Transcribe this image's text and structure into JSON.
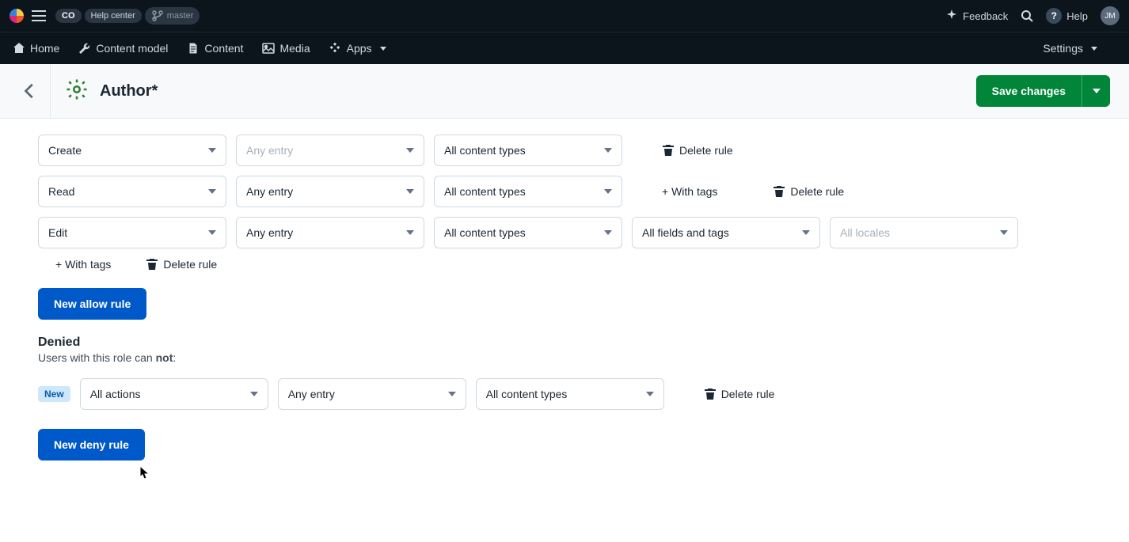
{
  "topbar": {
    "org_badge": "CO",
    "help_center": "Help center",
    "branch": "master",
    "feedback": "Feedback",
    "help": "Help",
    "avatar_initials": "JM"
  },
  "navbar": {
    "home": "Home",
    "content_model": "Content model",
    "content": "Content",
    "media": "Media",
    "apps": "Apps",
    "settings": "Settings"
  },
  "header": {
    "title": "Author*",
    "save_label": "Save changes"
  },
  "rules": {
    "allow": [
      {
        "action": "Create",
        "scope": "Any entry",
        "scope_placeholder": true,
        "types": "All content types",
        "actions": [
          {
            "kind": "delete",
            "label": "Delete rule"
          }
        ]
      },
      {
        "action": "Read",
        "scope": "Any entry",
        "types": "All content types",
        "actions": [
          {
            "kind": "tags",
            "label": "+ With tags"
          },
          {
            "kind": "delete",
            "label": "Delete rule"
          }
        ]
      },
      {
        "action": "Edit",
        "scope": "Any entry",
        "types": "All content types",
        "fields": "All fields and tags",
        "locales": "All locales",
        "locales_placeholder": true,
        "sub": [
          {
            "kind": "tags",
            "label": "+ With tags"
          },
          {
            "kind": "delete",
            "label": "Delete rule"
          }
        ]
      }
    ],
    "new_allow_btn": "New allow rule",
    "denied": {
      "heading": "Denied",
      "subtext_prefix": "Users with this role can ",
      "subtext_bold": "not",
      "subtext_suffix": ":",
      "new_badge": "New",
      "row": {
        "action": "All actions",
        "scope": "Any entry",
        "types": "All content types",
        "delete": "Delete rule"
      },
      "new_deny_btn": "New deny rule"
    }
  }
}
